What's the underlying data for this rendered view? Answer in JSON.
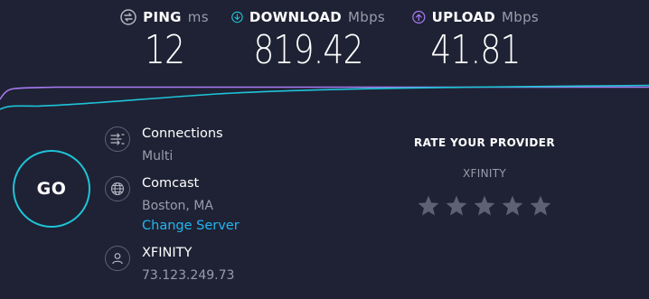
{
  "metrics": {
    "ping": {
      "label": "PING",
      "unit": "ms",
      "value": "12",
      "icon": "ping-icon",
      "color": "#b5b7c3"
    },
    "download": {
      "label": "DOWNLOAD",
      "unit": "Mbps",
      "value": "819.42",
      "icon": "download-arrow-icon",
      "color": "#1ec4d8"
    },
    "upload": {
      "label": "UPLOAD",
      "unit": "Mbps",
      "value": "41.81",
      "icon": "upload-arrow-icon",
      "color": "#a77bf2"
    }
  },
  "go_button": {
    "label": "GO"
  },
  "connections": {
    "title": "Connections",
    "value": "Multi",
    "icon": "connections-icon"
  },
  "server": {
    "title": "Comcast",
    "location": "Boston, MA",
    "change_link": "Change Server",
    "icon": "globe-icon"
  },
  "isp": {
    "title": "XFINITY",
    "ip": "73.123.249.73",
    "icon": "user-icon"
  },
  "rate": {
    "title": "RATE YOUR PROVIDER",
    "provider": "XFINITY",
    "stars_filled": 0,
    "stars_total": 5
  },
  "colors": {
    "background": "#1f2234",
    "download_accent": "#1ec4d8",
    "upload_accent": "#a77bf2",
    "link": "#21b6ef",
    "muted_text": "#9a9cab",
    "star": "#5e6173"
  }
}
